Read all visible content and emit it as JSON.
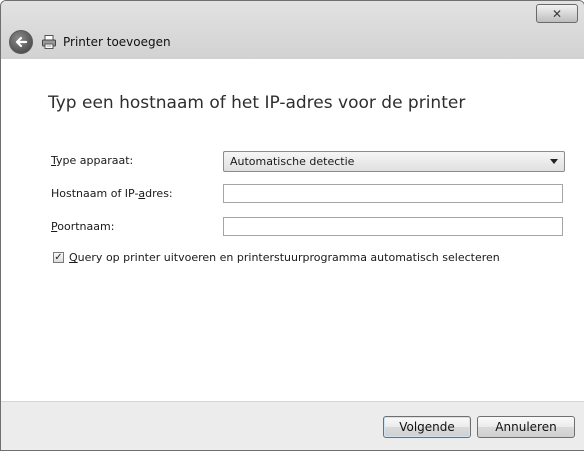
{
  "window": {
    "title": "Printer toevoegen",
    "close_glyph": "✕"
  },
  "main": {
    "heading": "Typ een hostnaam of het IP-adres voor de printer"
  },
  "form": {
    "device_type": {
      "label_accel": "T",
      "label_rest": "ype apparaat:",
      "value": "Automatische detectie"
    },
    "hostname": {
      "label_pre": "Hostnaam of IP-",
      "label_accel": "a",
      "label_post": "dres:",
      "value": ""
    },
    "port": {
      "label_accel": "P",
      "label_rest": "oortnaam:",
      "value": ""
    },
    "query_checkbox": {
      "checked": true,
      "label_accel": "Q",
      "label_rest": "uery op printer uitvoeren en printerstuurprogramma automatisch selecteren"
    }
  },
  "footer": {
    "next_label": "Volgende",
    "cancel_label": "Annuleren"
  },
  "icons": {
    "back": "back-arrow-icon",
    "printer": "printer-icon",
    "close": "close-icon"
  }
}
